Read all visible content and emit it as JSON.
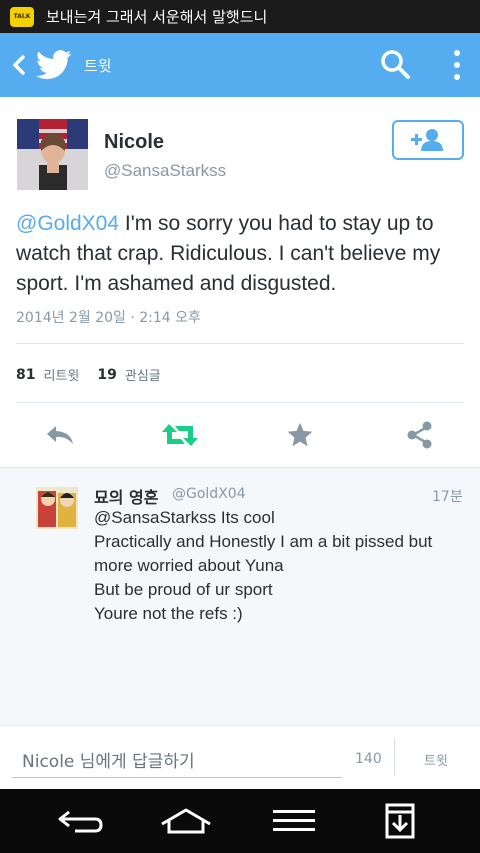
{
  "status_bar": {
    "app_badge": "TALK",
    "notification_text": "보내는겨 그래서 서운해서 말햇드니"
  },
  "app_bar": {
    "title": "트윗",
    "icons": [
      "back-arrow-icon",
      "twitter-bird-icon",
      "search-icon",
      "overflow-menu-icon"
    ]
  },
  "tweet": {
    "user_name": "Nicole",
    "user_handle": "@SansaStarkss",
    "mention": "@GoldX04",
    "text": " I'm so sorry you had to stay up to watch that crap. Ridiculous. I can't believe my sport. I'm ashamed and disgusted.",
    "timestamp": "2014년 2월 20일 · 2:14 오후",
    "retweets_count": "81",
    "retweets_label": "리트윗",
    "favorites_count": "19",
    "favorites_label": "관심글",
    "actions": [
      "reply-icon",
      "retweet-icon",
      "favorite-star-icon",
      "share-icon"
    ],
    "colors": {
      "accent": "#55acee",
      "retweet_green": "#19cf86"
    }
  },
  "reply": {
    "user_name": "묘의 영혼",
    "user_handle": "@GoldX04",
    "time": "17분",
    "lines": [
      "@SansaStarkss Its cool",
      "Practically and Honestly I am a bit pissed but more worried about Yuna",
      "But be proud of ur sport",
      "Youre not the refs :)"
    ]
  },
  "compose": {
    "placeholder": "Nicole 님에게 답글하기",
    "char_count": "140",
    "send_label": "트윗"
  },
  "nav_bar": {
    "icons": [
      "back-icon",
      "home-icon",
      "menu-icon",
      "download-icon"
    ]
  }
}
